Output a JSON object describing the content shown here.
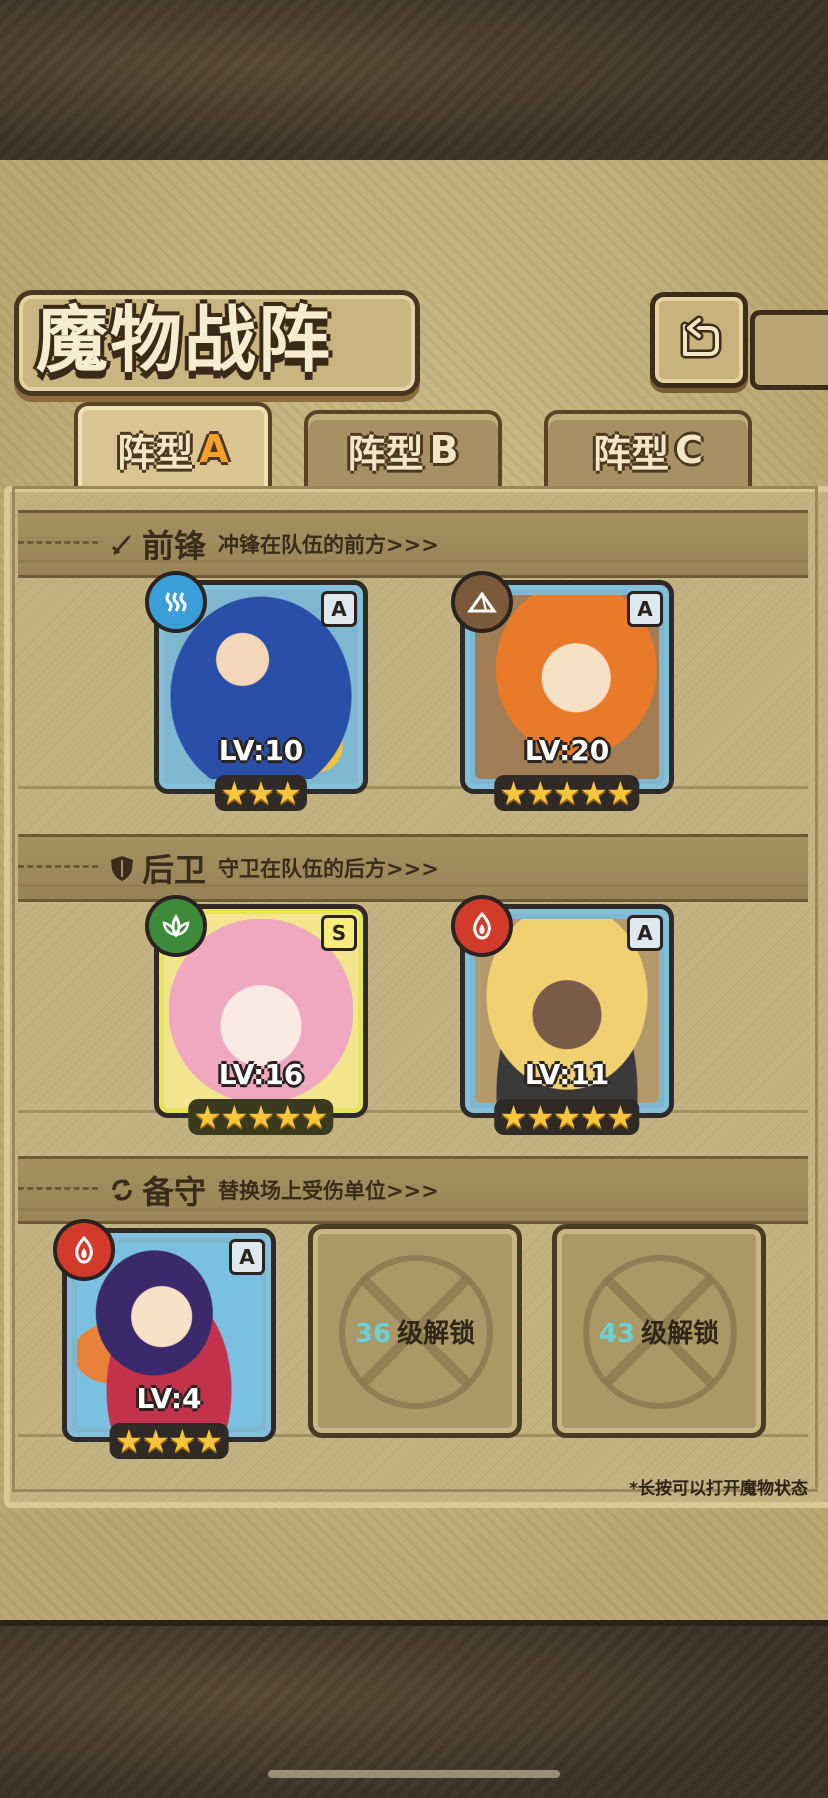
{
  "header": {
    "title": "魔物战阵",
    "back_icon": "back-return-icon"
  },
  "tabs": [
    {
      "prefix": "阵型",
      "letter": "A",
      "active": true
    },
    {
      "prefix": "阵型",
      "letter": "B",
      "active": false
    },
    {
      "prefix": "阵型",
      "letter": "C",
      "active": false
    }
  ],
  "sections": {
    "front": {
      "icon": "sword-icon",
      "title": "前锋",
      "desc": "冲锋在队伍的前方>>>"
    },
    "back": {
      "icon": "shield-icon",
      "title": "后卫",
      "desc": "守卫在队伍的后方>>>"
    },
    "reserve": {
      "icon": "swap-icon",
      "title": "备守",
      "desc": "替换场上受伤单位>>>"
    }
  },
  "cards": {
    "front_1": {
      "element": "water",
      "element_color": "#3a9fd8",
      "rank": "A",
      "level": "LV:10",
      "stars": 3
    },
    "front_2": {
      "element": "earth",
      "element_color": "#7a5a3a",
      "rank": "A",
      "level": "LV:20",
      "stars": 5
    },
    "back_1": {
      "element": "wood",
      "element_color": "#3d8a3a",
      "rank": "S",
      "level": "LV:16",
      "stars": 5
    },
    "back_2": {
      "element": "fire",
      "element_color": "#d23a2a",
      "rank": "A",
      "level": "LV:11",
      "stars": 5
    },
    "reserve_1": {
      "element": "fire",
      "element_color": "#d23a2a",
      "rank": "A",
      "level": "LV:4",
      "stars": 4
    }
  },
  "locked_slots": [
    {
      "level": "36",
      "label": "级解锁"
    },
    {
      "level": "43",
      "label": "级解锁"
    }
  ],
  "footnote": "*长按可以打开魔物状态"
}
